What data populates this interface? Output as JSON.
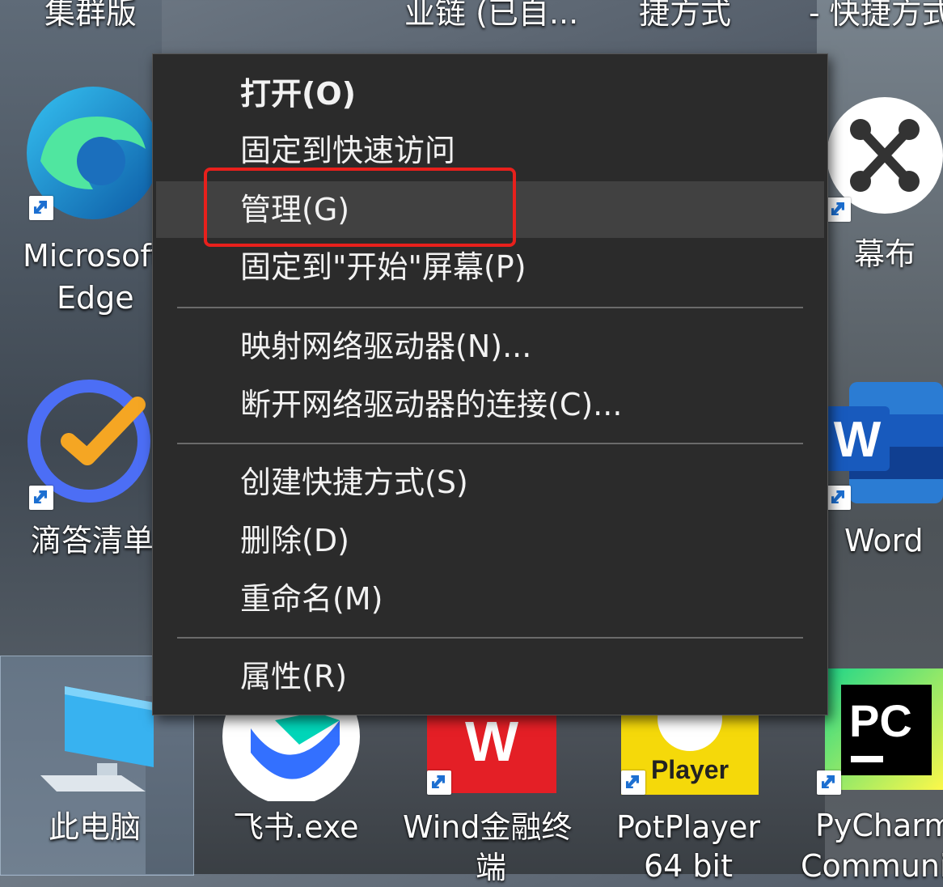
{
  "desktop": {
    "top_labels": [
      "集群版",
      "业链 (已自...",
      "捷方式",
      "- 快捷方式"
    ],
    "left_icons": [
      {
        "label_line1": "Microsoft",
        "label_line2": "Edge",
        "icon": "edge-icon"
      },
      {
        "label": "滴答清单",
        "icon": "ticktick-icon"
      }
    ],
    "right_icons": [
      {
        "label": "幕布",
        "icon": "mubu-icon"
      },
      {
        "label": "Word",
        "icon": "word-icon"
      },
      {
        "label_line1": "PyCharm",
        "label_line2": "Communi",
        "icon": "pycharm-icon"
      }
    ],
    "bottom_icons": [
      {
        "label": "此电脑",
        "icon": "this-pc-icon"
      },
      {
        "label": "飞书.exe",
        "icon": "feishu-icon"
      },
      {
        "label_line1": "Wind金融终",
        "label_line2": "端",
        "icon": "wind-icon",
        "icon_text": "W"
      },
      {
        "label_line1": "PotPlayer",
        "label_line2": "64 bit",
        "icon": "potplayer-icon",
        "icon_text": "Player"
      },
      {
        "icon_text": "PC"
      }
    ]
  },
  "context_menu": {
    "groups": [
      [
        {
          "label": "打开(O)",
          "bold": true
        },
        {
          "label": "固定到快速访问"
        },
        {
          "label": "管理(G)",
          "hovered": true
        },
        {
          "label": "固定到\"开始\"屏幕(P)"
        }
      ],
      [
        {
          "label": "映射网络驱动器(N)..."
        },
        {
          "label": "断开网络驱动器的连接(C)..."
        }
      ],
      [
        {
          "label": "创建快捷方式(S)"
        },
        {
          "label": "删除(D)"
        },
        {
          "label": "重命名(M)"
        }
      ],
      [
        {
          "label": "属性(R)"
        }
      ]
    ]
  },
  "colors": {
    "menu_bg": "#2b2b2b",
    "menu_hover": "#414141",
    "menu_text": "#f2f2f2",
    "highlight_border": "#e8201c"
  }
}
